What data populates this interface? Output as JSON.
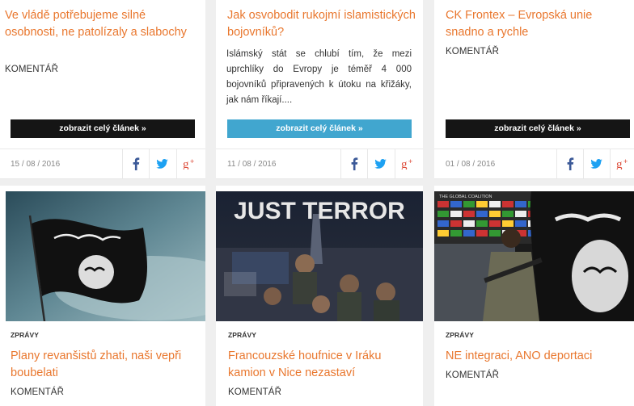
{
  "top_cards": [
    {
      "title": "Ve vládě potřebujeme silné osobnosti, ne patolízaly a slabochy",
      "category": "KOMENTÁŘ",
      "button": "zobrazit celý článek »",
      "date": "15 / 08 / 2016"
    },
    {
      "title": "Jak osvobodit rukojmí islamistických bojovníků?",
      "excerpt": "Islámský stát se chlubí tím, že mezi uprchlíky do Evropy je téměř 4 000 bojovníků připravených k útoku na křižáky, jak nám říkají....",
      "button": "zobrazit celý článek »",
      "date": "11 / 08 / 2016"
    },
    {
      "title": "CK Frontex – Evropská unie snadno a rychle",
      "category": "KOMENTÁŘ",
      "button": "zobrazit celý článek »",
      "date": "01 / 08 / 2016"
    }
  ],
  "bottom_cards": [
    {
      "section": "ZPRÁVY",
      "title": "Plany revanšistů zhati, naši vepři boubelati",
      "category": "KOMENTÁŘ",
      "image": "black-flag-photo"
    },
    {
      "section": "ZPRÁVY",
      "title": "Francouzské houfnice v Iráku kamion v Nice nezastaví",
      "category": "KOMENTÁŘ",
      "image": "just-terror-poster",
      "image_text": "JUST TERROR"
    },
    {
      "section": "ZPRÁVY",
      "title": "NE integraci, ANO deportaci",
      "category": "KOMENTÁŘ",
      "image": "global-coalition-fighter",
      "image_text": "THE GLOBAL COALITION"
    }
  ],
  "colors": {
    "accent": "#e9772e",
    "button_dark": "#151515",
    "button_blue": "#41a6cf",
    "facebook": "#3b5998",
    "twitter": "#1da1f2",
    "google_plus": "#dd4b39"
  },
  "icons": [
    "facebook-icon",
    "twitter-icon",
    "google-plus-icon"
  ]
}
